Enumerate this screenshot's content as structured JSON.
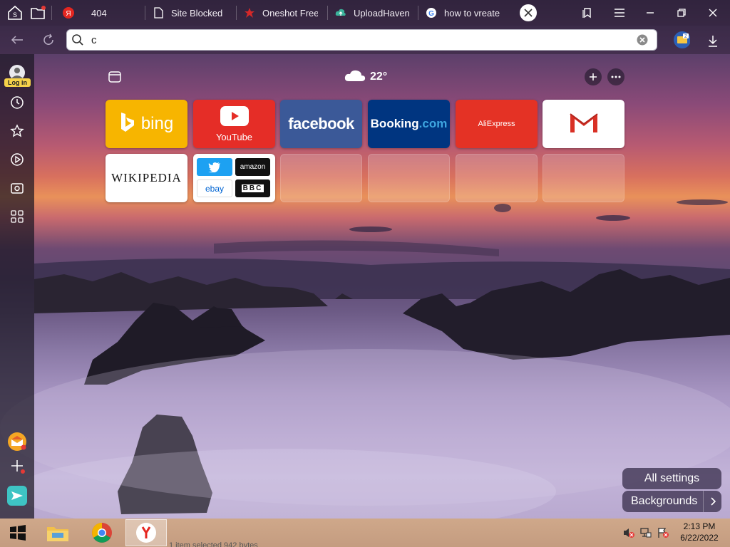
{
  "tabs": [
    {
      "label": "404",
      "favicon": "yandex-icon"
    },
    {
      "label": "Site Blocked",
      "favicon": "page-icon"
    },
    {
      "label": "Oneshot Free",
      "favicon": "oneshot-icon"
    },
    {
      "label": "UploadHaven",
      "favicon": "uploadhaven-icon"
    },
    {
      "label": "how to vreate",
      "favicon": "google-icon"
    }
  ],
  "address": {
    "value": "c"
  },
  "sidebar": {
    "login_label": "Log in"
  },
  "weather": {
    "temp": "22°",
    "icon": "cloud-icon"
  },
  "tiles": {
    "bing": "bing",
    "youtube": "YouTube",
    "facebook": "facebook",
    "booking_main": "Booking",
    "booking_dot": ".com",
    "aliexpress": "AliExpress",
    "wikipedia": "WIKIPEDIA",
    "group": {
      "amazon": "amazon",
      "ebay": "ebay",
      "bbc": "BBC"
    }
  },
  "buttons": {
    "all_settings": "All settings",
    "backgrounds": "Backgrounds"
  },
  "taskbar": {
    "time": "2:13 PM",
    "date": "6/22/2022",
    "status": "1 item selected  942 bytes"
  },
  "colors": {
    "bing": "#f7b500",
    "youtube": "#e52d27",
    "facebook": "#3b5998",
    "booking": "#003580",
    "aliexpress": "#e43225",
    "accent": "#ffcc00"
  }
}
